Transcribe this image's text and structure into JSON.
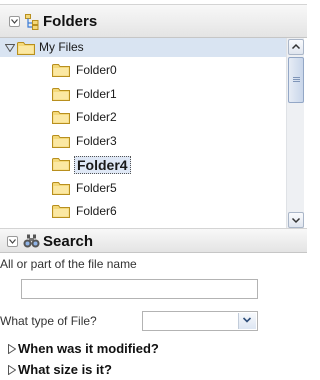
{
  "folders_panel": {
    "title": "Folders",
    "root": {
      "label": "My Files",
      "expanded": true
    },
    "items": [
      {
        "label": "Folder0"
      },
      {
        "label": "Folder1"
      },
      {
        "label": "Folder2"
      },
      {
        "label": "Folder3"
      },
      {
        "label": "Folder4",
        "selected": true
      },
      {
        "label": "Folder5"
      },
      {
        "label": "Folder6"
      }
    ]
  },
  "search_panel": {
    "title": "Search",
    "name_label": "All or part of the file name",
    "name_value": "",
    "type_label": "What type of File?",
    "type_value": "",
    "modified_label": "When was it modified?",
    "size_label": "What size is it?"
  },
  "colors": {
    "selection": "#d9e4f2",
    "folder_fill": "#f4d97a",
    "folder_stroke": "#b88f1e",
    "scroll_blue": "#c9d6ea"
  }
}
